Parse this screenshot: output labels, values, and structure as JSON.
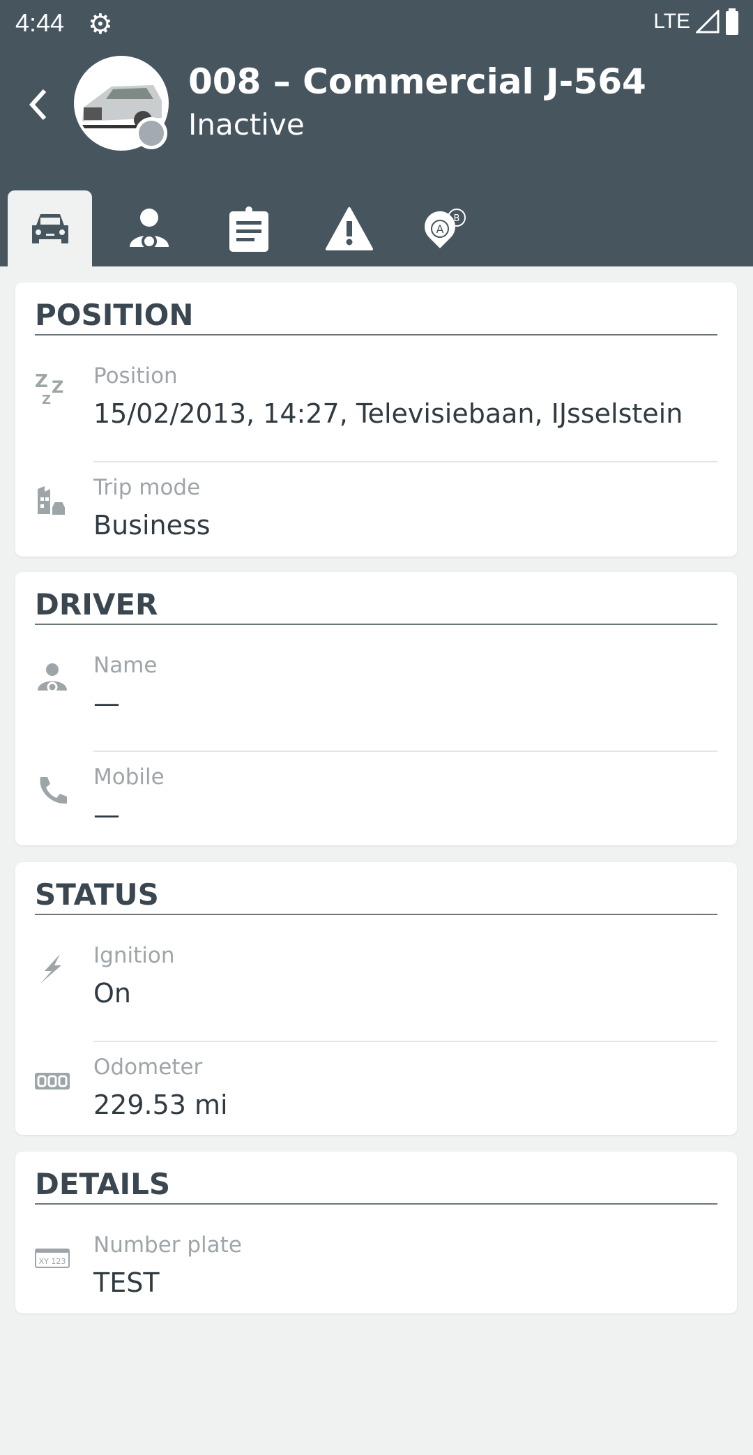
{
  "status_bar": {
    "time": "4:44",
    "network": "LTE"
  },
  "header": {
    "title": "008 – Commercial J-564",
    "subtitle": "Inactive"
  },
  "tabs": [
    {
      "icon": "car-icon",
      "active": true
    },
    {
      "icon": "driver-icon"
    },
    {
      "icon": "clipboard-icon"
    },
    {
      "icon": "warning-icon"
    },
    {
      "icon": "route-ab-icon"
    }
  ],
  "sections": {
    "position": {
      "title": "POSITION",
      "rows": [
        {
          "label": "Position",
          "value": "15/02/2013, 14:27, Televisiebaan, IJsselstein",
          "icon": "sleep-zzz-icon"
        },
        {
          "label": "Trip mode",
          "value": "Business",
          "icon": "business-trip-icon"
        }
      ]
    },
    "driver": {
      "title": "DRIVER",
      "rows": [
        {
          "label": "Name",
          "value": "—",
          "icon": "driver-icon"
        },
        {
          "label": "Mobile",
          "value": "—",
          "icon": "phone-icon"
        }
      ]
    },
    "status": {
      "title": "STATUS",
      "rows": [
        {
          "label": "Ignition",
          "value": "On",
          "icon": "lightning-icon"
        },
        {
          "label": "Odometer",
          "value": "229.53 mi",
          "icon": "odometer-icon"
        }
      ]
    },
    "details": {
      "title": "DETAILS",
      "rows": [
        {
          "label": "Number plate",
          "value": "TEST",
          "icon": "number-plate-icon",
          "icon_text": "XY 123"
        }
      ]
    }
  },
  "colors": {
    "header": "#47555f",
    "background": "#f0f2f1",
    "status_dot": "#a3abb0"
  }
}
